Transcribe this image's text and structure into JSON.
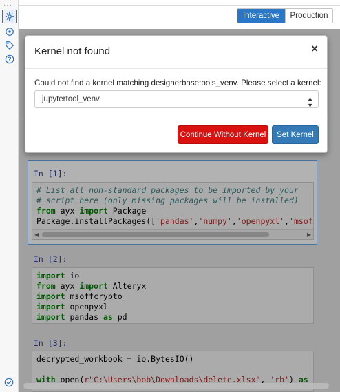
{
  "mode_toggle": {
    "interactive": "Interactive",
    "production": "Production"
  },
  "rail": {
    "dots": "···",
    "icons": [
      "gear-icon",
      "connections-icon",
      "tag-icon",
      "help-icon"
    ],
    "bottom_icon": "check-circle-icon"
  },
  "cells": [
    {
      "prompt": "In [1]:",
      "lines": [
        "# List all non-standard packages to be imported by your",
        "# script here (only missing packages will be installed)",
        "from ayx import Package",
        "Package.installPackages(['pandas','numpy','openpyxl','msoffc"
      ]
    },
    {
      "prompt": "In [2]:",
      "lines": [
        "import io",
        "from ayx import Alteryx",
        "import msoffcrypto",
        "import openpyxl",
        "import pandas as pd"
      ]
    },
    {
      "prompt": "In [3]:",
      "lines": [
        "decrypted_workbook = io.BytesIO()",
        "",
        "with open(r\"C:\\Users\\bob\\Downloads\\delete.xlsx\", 'rb') as fi"
      ]
    }
  ],
  "modal": {
    "title": "Kernel not found",
    "close": "×",
    "message": "Could not find a kernel matching designerbasetools_venv. Please select a kernel:",
    "selected_kernel": "jupytertool_venv",
    "continue_label": "Continue Without Kernel",
    "set_label": "Set Kernel"
  },
  "colors": {
    "accent": "#2a77c8",
    "danger": "#d9120f",
    "primary": "#337ab7"
  }
}
